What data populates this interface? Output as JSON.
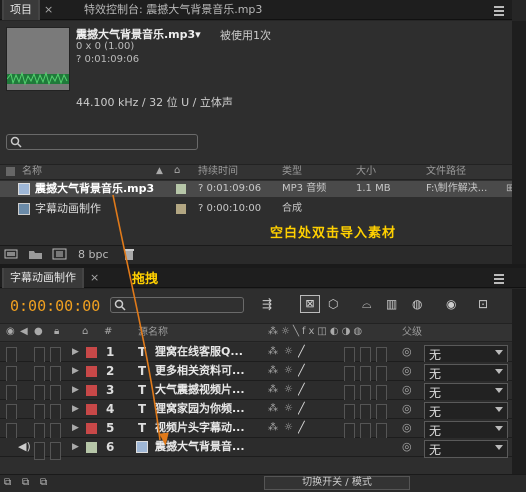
{
  "project_panel": {
    "tab_active": "项目",
    "tab_inactive": "特效控制台: 震撼大气背景音乐.mp3",
    "file_name": "震撼大气背景音乐.mp3▾",
    "used_count": "被使用1次",
    "info_line1": "0 x 0 (1.00)",
    "info_line2": "? 0:01:09:06",
    "audio_info": "44.100 kHz / 32 位 U / 立体声",
    "search_icon": "search-icon",
    "columns": [
      "名称",
      "持续时间",
      "类型",
      "大小",
      "文件路径"
    ],
    "items": [
      {
        "name": "震撼大气背景音乐.mp3",
        "color": "#b6c6a8",
        "duration": "? 0:01:09:06",
        "type": "MP3 音频",
        "size": "1.1 MB",
        "path": "F:\\制作解决...",
        "selected": true
      },
      {
        "name": "字幕动画制作",
        "color": "#b2a682",
        "duration": "? 0:00:10:00",
        "type": "合成",
        "size": "",
        "path": "",
        "selected": false
      }
    ],
    "bpc_label": "8 bpc",
    "annotation": "空白处双击导入素材"
  },
  "timeline_panel": {
    "tab": "字幕动画制作",
    "annotation": "拖拽",
    "timecode": "0:00:00:00",
    "col_name": "源名称",
    "col_parent": "父级",
    "layers": [
      {
        "num": "1",
        "name": "狸窝在线客服Q...",
        "color": "#c84848",
        "type": "T",
        "parent": "无"
      },
      {
        "num": "2",
        "name": "更多相关资料可...",
        "color": "#c84848",
        "type": "T",
        "parent": "无"
      },
      {
        "num": "3",
        "name": "大气震撼视频片...",
        "color": "#c84848",
        "type": "T",
        "parent": "无"
      },
      {
        "num": "4",
        "name": "狸窝家园为你频...",
        "color": "#c84848",
        "type": "T",
        "parent": "无"
      },
      {
        "num": "5",
        "name": "视频片头字幕动...",
        "color": "#c84848",
        "type": "T",
        "parent": "无"
      },
      {
        "num": "6",
        "name": "震撼大气背景音...",
        "color": "#b6c6a8",
        "type": "audio",
        "parent": "无"
      }
    ],
    "footer_button": "切换开关 / 模式"
  },
  "colors": {
    "accent_orange": "#f0a020",
    "annotation_yellow": "#ffd000",
    "arrow": "#e07a1a"
  }
}
